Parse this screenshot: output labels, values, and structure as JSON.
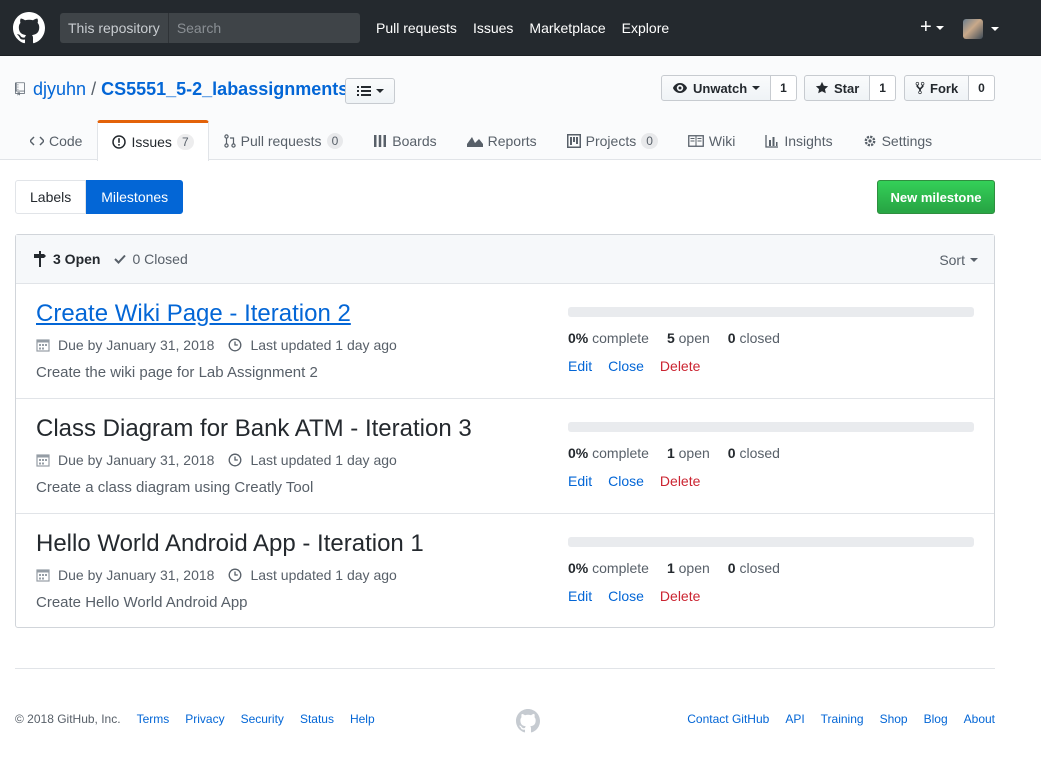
{
  "header": {
    "search_scope": "This repository",
    "search_placeholder": "Search",
    "nav": [
      "Pull requests",
      "Issues",
      "Marketplace",
      "Explore"
    ],
    "plus_label": "+"
  },
  "repo": {
    "owner": "djyuhn",
    "separator": "/",
    "name": "CS5551_5-2_labassignments",
    "watch": {
      "label": "Unwatch",
      "count": "1"
    },
    "star": {
      "label": "Star",
      "count": "1"
    },
    "fork": {
      "label": "Fork",
      "count": "0"
    }
  },
  "tabs": [
    {
      "label": "Code",
      "icon": "code-icon"
    },
    {
      "label": "Issues",
      "counter": "7",
      "icon": "issue-icon"
    },
    {
      "label": "Pull requests",
      "counter": "0",
      "icon": "pull-request-icon"
    },
    {
      "label": "Boards",
      "icon": "boards-icon"
    },
    {
      "label": "Reports",
      "icon": "graph-icon"
    },
    {
      "label": "Projects",
      "counter": "0",
      "icon": "project-icon"
    },
    {
      "label": "Wiki",
      "icon": "book-icon"
    },
    {
      "label": "Insights",
      "icon": "insights-icon"
    },
    {
      "label": "Settings",
      "icon": "gear-icon"
    }
  ],
  "subnav": {
    "labels": "Labels",
    "milestones": "Milestones",
    "new_milestone": "New milestone"
  },
  "states": {
    "open": "3 Open",
    "closed": "0 Closed",
    "sort": "Sort"
  },
  "milestones": [
    {
      "title": "Create Wiki Page - Iteration 2",
      "due": "Due by January 31, 2018",
      "updated": "Last updated 1 day ago",
      "description": "Create the wiki page for Lab Assignment 2",
      "percent": "0%",
      "percent_label": "complete",
      "open": "5",
      "open_label": "open",
      "closed": "0",
      "closed_label": "closed",
      "progress": 0
    },
    {
      "title": "Class Diagram for Bank ATM - Iteration 3",
      "due": "Due by January 31, 2018",
      "updated": "Last updated 1 day ago",
      "description": "Create a class diagram using Creatly Tool",
      "percent": "0%",
      "percent_label": "complete",
      "open": "1",
      "open_label": "open",
      "closed": "0",
      "closed_label": "closed",
      "progress": 0
    },
    {
      "title": "Hello World Android App - Iteration 1",
      "due": "Due by January 31, 2018",
      "updated": "Last updated 1 day ago",
      "description": "Create Hello World Android App",
      "percent": "0%",
      "percent_label": "complete",
      "open": "1",
      "open_label": "open",
      "closed": "0",
      "closed_label": "closed",
      "progress": 0
    }
  ],
  "milestone_actions": {
    "edit": "Edit",
    "close": "Close",
    "delete": "Delete"
  },
  "footer": {
    "copyright": "© 2018 GitHub, Inc.",
    "left_links": [
      "Terms",
      "Privacy",
      "Security",
      "Status",
      "Help"
    ],
    "right_links": [
      "Contact GitHub",
      "API",
      "Training",
      "Shop",
      "Blog",
      "About"
    ]
  },
  "colors": {
    "header_bg": "#24292e",
    "link": "#0366d6",
    "primary_green": "#28a745",
    "tab_accent": "#e36209",
    "danger": "#cb2431"
  }
}
